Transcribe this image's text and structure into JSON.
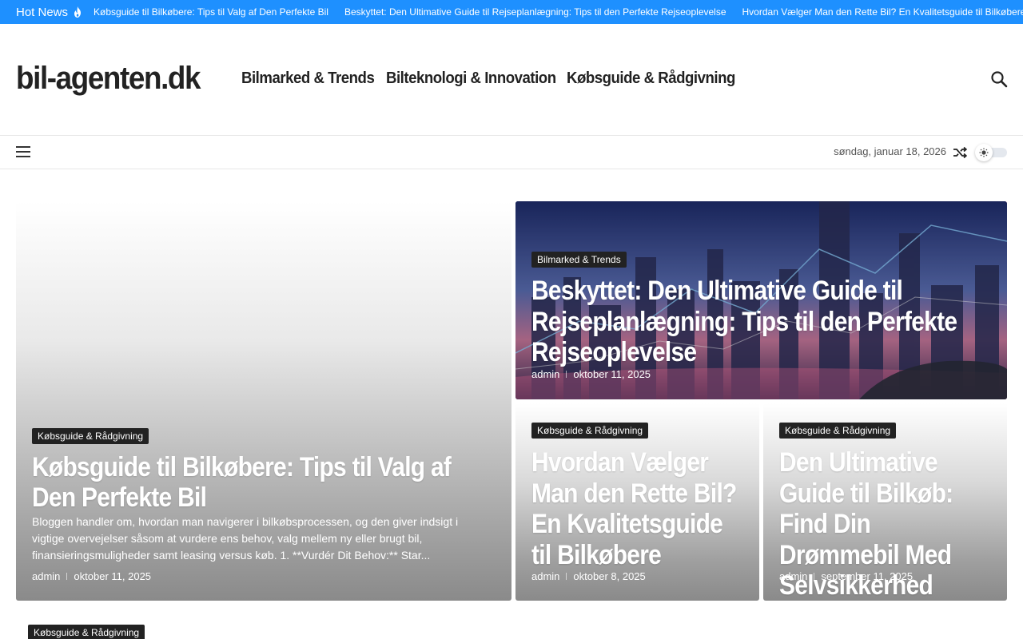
{
  "ticker": {
    "label": "Hot News",
    "items": [
      "Købsguide til Bilkøbere: Tips til Valg af Den Perfekte Bil",
      "Beskyttet: Den Ultimative Guide til Rejseplanlægning: Tips til den Perfekte Rejseoplevelse",
      "Hvordan Vælger Man den Rette Bil? En Kvalitetsguide til Bilkøbere"
    ]
  },
  "header": {
    "logo": "bil-agenten.dk",
    "nav": [
      "Bilmarked & Trends",
      "Bilteknologi & Innovation",
      "Købsguide & Rådgivning"
    ]
  },
  "subbar": {
    "date": "søndag, januar 18, 2026"
  },
  "posts": {
    "big": {
      "category": "Købsguide & Rådgivning",
      "title": "Købsguide til Bilkøbere: Tips til Valg af Den Perfekte Bil",
      "excerpt": "Bloggen handler om, hvordan man navigerer i bilkøbsprocessen, og den giver indsigt i vigtige overvejelser såsom at vurdere ens behov, valg mellem ny eller brugt bil, finansieringsmuligheder samt leasing versus køb. 1. **Vurdér Dit Behov:** Star...",
      "author": "admin",
      "date": "oktober 11, 2025"
    },
    "top": {
      "category": "Bilmarked & Trends",
      "title": "Beskyttet: Den Ultimative Guide til Rejseplanlægning: Tips til den Perfekte Rejseoplevelse",
      "author": "admin",
      "date": "oktober 11, 2025"
    },
    "small1": {
      "category": "Købsguide & Rådgivning",
      "title": "Hvordan Vælger Man den Rette Bil? En Kvalitetsguide til Bilkøbere",
      "author": "admin",
      "date": "oktober 8, 2025"
    },
    "small2": {
      "category": "Købsguide & Rådgivning",
      "title": "Den Ultimative Guide til Bilkøb: Find Din Drømmebil Med Selvsikkerhed",
      "author": "admin",
      "date": "september 11, 2025"
    }
  },
  "bottom": {
    "category": "Købsguide & Rådgivning"
  },
  "colors": {
    "ticker_bg": "#1e90ff",
    "text_dark": "#222222",
    "category_bg": "#222222"
  },
  "icons": {
    "hot": "flame-icon",
    "search": "search-icon",
    "menu": "menu-icon",
    "shuffle": "shuffle-icon",
    "theme": "sun-icon"
  }
}
